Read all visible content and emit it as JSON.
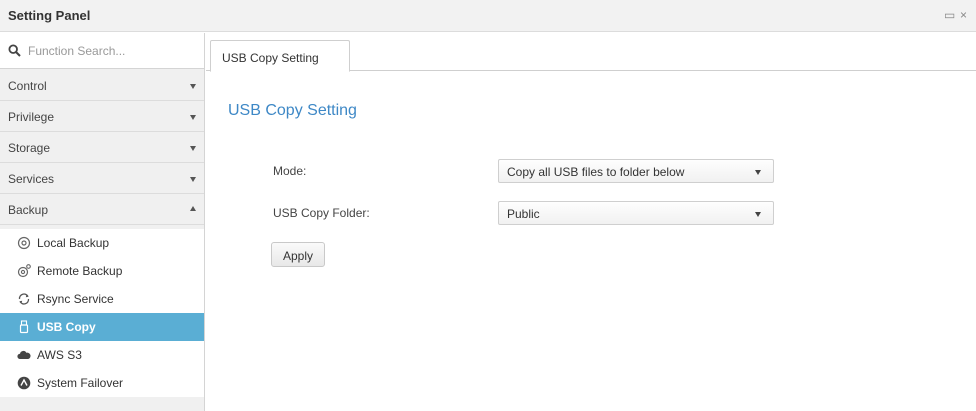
{
  "window": {
    "title": "Setting Panel",
    "controls": {
      "restore_glyph": "▭",
      "close_glyph": "×"
    }
  },
  "search": {
    "placeholder": "Function Search..."
  },
  "sidebar": {
    "categories": [
      {
        "label": "Control",
        "expanded": false
      },
      {
        "label": "Privilege",
        "expanded": false
      },
      {
        "label": "Storage",
        "expanded": false
      },
      {
        "label": "Services",
        "expanded": false
      },
      {
        "label": "Backup",
        "expanded": true
      }
    ],
    "backup_items": [
      {
        "label": "Local Backup",
        "icon": "local-backup-icon"
      },
      {
        "label": "Remote Backup",
        "icon": "remote-backup-icon"
      },
      {
        "label": "Rsync Service",
        "icon": "rsync-icon"
      },
      {
        "label": "USB Copy",
        "icon": "usb-icon",
        "active": true
      },
      {
        "label": "AWS S3",
        "icon": "cloud-icon"
      },
      {
        "label": "System Failover",
        "icon": "failover-icon"
      }
    ]
  },
  "tabs": [
    {
      "label": "USB Copy Setting",
      "active": true
    }
  ],
  "form": {
    "heading": "USB Copy Setting",
    "mode": {
      "label": "Mode:",
      "value": "Copy all USB files to folder below"
    },
    "folder": {
      "label": "USB Copy Folder:",
      "value": "Public"
    },
    "apply_label": "Apply"
  },
  "colors": {
    "accent": "#5aaed4",
    "heading": "#3e88c6"
  }
}
